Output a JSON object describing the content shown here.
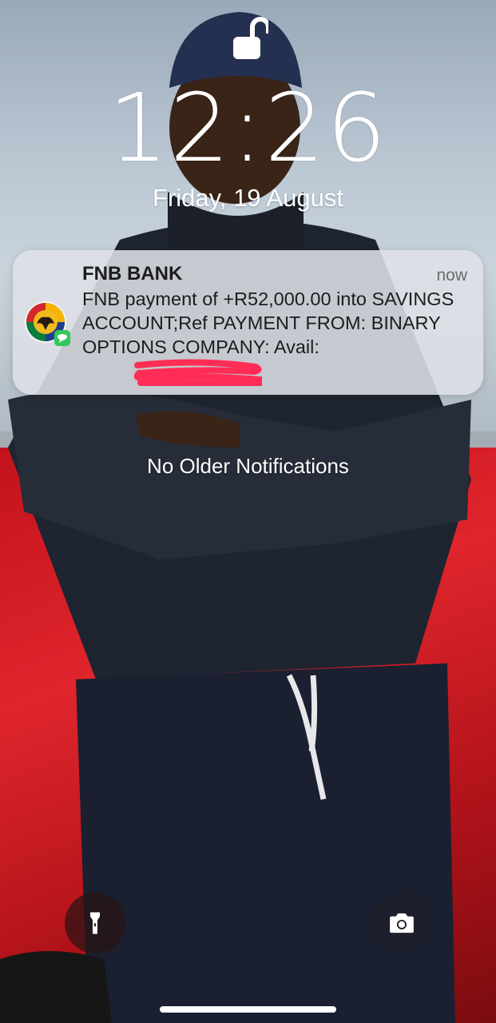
{
  "lock_screen": {
    "time": "12:26",
    "date": "Friday, 19 August",
    "lock_state_icon": "unlocked-padlock-icon"
  },
  "notification": {
    "app_name": "FNB BANK",
    "timestamp": "now",
    "app_icon": "fnb-messages-icon",
    "body": "FNB payment of +R52,000.00 into SAVINGS ACCOUNT;Ref PAYMENT FROM: BINARY OPTIONS COMPANY: Avail:"
  },
  "no_older_label": "No Older Notifications",
  "quick_actions": {
    "flashlight_icon": "flashlight-icon",
    "camera_icon": "camera-icon"
  },
  "colors": {
    "redaction": "#ff2d55",
    "notification_bg": "#dee0e6",
    "wallpaper_car": "#d8202a"
  }
}
